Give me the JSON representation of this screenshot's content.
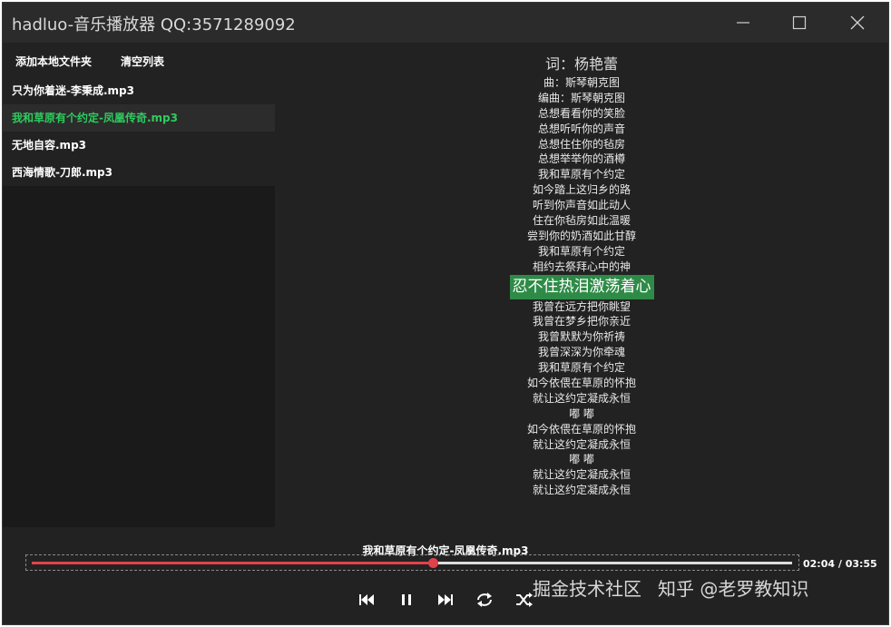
{
  "window": {
    "title": "hadluo-音乐播放器 QQ:3571289092"
  },
  "toolbar": {
    "add_folder_label": "添加本地文件夹",
    "clear_list_label": "清空列表"
  },
  "playlist": {
    "songs": [
      "只为你着迷-李秉成.mp3",
      "我和草原有个约定-凤凰传奇.mp3",
      "无地自容.mp3",
      "西海情歌-刀郎.mp3"
    ],
    "active_index": 1
  },
  "lyrics": {
    "author": "词：杨艳蕾",
    "before": [
      "曲：斯琴朝克图",
      "编曲：斯琴朝克图",
      "总想看看你的笑脸",
      "总想听听你的声音",
      "总想住住你的毡房",
      "总想举举你的酒樽",
      "我和草原有个约定",
      "如今踏上这归乡的路",
      "听到你声音如此动人",
      "住在你毡房如此温暖",
      "尝到你的奶酒如此甘醇",
      "我和草原有个约定",
      "相约去祭拜心中的神"
    ],
    "current": "忍不住热泪激荡着心",
    "after": [
      "我曾在远方把你眺望",
      "我曾在梦乡把你亲近",
      "我曾默默为你祈祷",
      "我曾深深为你牵魂",
      "我和草原有个约定",
      "如今依偎在草原的怀抱",
      "就让这约定凝成永恒",
      "嘟 嘟",
      "如今依偎在草原的怀抱",
      "就让这约定凝成永恒",
      "嘟 嘟",
      "就让这约定凝成永恒",
      "就让这约定凝成永恒"
    ]
  },
  "player": {
    "now_playing": "我和草原有个约定-凤凰传奇.mp3",
    "time_display": "02:04 / 03:55",
    "progress_fraction": 0.528
  },
  "watermark": {
    "left": "掘金技术社区",
    "right": "知乎 @老罗教知识"
  },
  "colors": {
    "accent_green": "#2ecc5f",
    "highlight_green": "#2e8b47",
    "progress_red": "#e0424b"
  }
}
